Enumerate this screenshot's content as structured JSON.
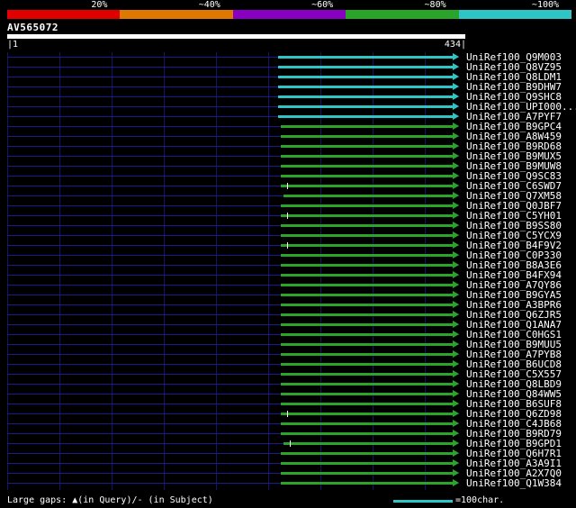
{
  "chart_data": {
    "type": "bar",
    "title": "AV565072",
    "x_range": [
      1,
      434
    ],
    "ruler_start_label": "|1",
    "ruler_end_label": "434|",
    "legend_position": "top",
    "grid": true,
    "scale_legend": [
      {
        "label": "20%",
        "color": "#e00000"
      },
      {
        "label": "~40%",
        "color": "#e07800"
      },
      {
        "label": "~60%",
        "color": "#8800c2"
      },
      {
        "label": "~80%",
        "color": "#2aa52a"
      },
      {
        "label": "~100%",
        "color": "#30c5c5"
      }
    ],
    "hits": [
      {
        "label": "UniRef100_Q9M003",
        "align_start": 261,
        "align_end": 434,
        "identity": "~100%",
        "color": "#30c5c5"
      },
      {
        "label": "UniRef100_Q8VZ95",
        "align_start": 261,
        "align_end": 434,
        "identity": "~100%",
        "color": "#30c5c5"
      },
      {
        "label": "UniRef100_Q8LDM1",
        "align_start": 261,
        "align_end": 434,
        "identity": "~100%",
        "color": "#30c5c5"
      },
      {
        "label": "UniRef100_B9DHW7",
        "align_start": 261,
        "align_end": 434,
        "identity": "~100%",
        "color": "#30c5c5"
      },
      {
        "label": "UniRef100_Q9SHC8",
        "align_start": 261,
        "align_end": 434,
        "identity": "~100%",
        "color": "#30c5c5"
      },
      {
        "label": "UniRef100_UPI000...",
        "align_start": 261,
        "align_end": 434,
        "identity": "~100%",
        "color": "#30c5c5"
      },
      {
        "label": "UniRef100_A7PYF7",
        "align_start": 261,
        "align_end": 434,
        "identity": "~100%",
        "color": "#30c5c5"
      },
      {
        "label": "UniRef100_B9GPC4",
        "align_start": 263,
        "align_end": 434,
        "identity": "~80%",
        "color": "#2aa52a"
      },
      {
        "label": "UniRef100_A8W459",
        "align_start": 263,
        "align_end": 434,
        "identity": "~80%",
        "color": "#2aa52a"
      },
      {
        "label": "UniRef100_B9RD68",
        "align_start": 263,
        "align_end": 434,
        "identity": "~80%",
        "color": "#2aa52a"
      },
      {
        "label": "UniRef100_B9MUX5",
        "align_start": 263,
        "align_end": 434,
        "identity": "~80%",
        "color": "#2aa52a"
      },
      {
        "label": "UniRef100_B9MUW8",
        "align_start": 263,
        "align_end": 434,
        "identity": "~80%",
        "color": "#2aa52a"
      },
      {
        "label": "UniRef100_Q9SC83",
        "align_start": 263,
        "align_end": 434,
        "identity": "~80%",
        "color": "#2aa52a"
      },
      {
        "label": "UniRef100_C6SWD7",
        "align_start": 263,
        "align_end": 434,
        "identity": "~80%",
        "color": "#2aa52a",
        "gap_tick": true,
        "tick_pos": 269
      },
      {
        "label": "UniRef100_Q7XM58",
        "align_start": 266,
        "align_end": 434,
        "identity": "~80%",
        "color": "#2aa52a"
      },
      {
        "label": "UniRef100_Q0JBF7",
        "align_start": 263,
        "align_end": 434,
        "identity": "~80%",
        "color": "#2aa52a"
      },
      {
        "label": "UniRef100_C5YH01",
        "align_start": 263,
        "align_end": 434,
        "identity": "~80%",
        "color": "#2aa52a",
        "gap_tick": true,
        "tick_pos": 269
      },
      {
        "label": "UniRef100_B9SS80",
        "align_start": 263,
        "align_end": 434,
        "identity": "~80%",
        "color": "#2aa52a"
      },
      {
        "label": "UniRef100_C5YCX9",
        "align_start": 263,
        "align_end": 434,
        "identity": "~80%",
        "color": "#2aa52a"
      },
      {
        "label": "UniRef100_B4F9V2",
        "align_start": 263,
        "align_end": 434,
        "identity": "~80%",
        "color": "#2aa52a",
        "gap_tick": true,
        "tick_pos": 269
      },
      {
        "label": "UniRef100_C0P330",
        "align_start": 263,
        "align_end": 434,
        "identity": "~80%",
        "color": "#2aa52a"
      },
      {
        "label": "UniRef100_B8A3E6",
        "align_start": 263,
        "align_end": 434,
        "identity": "~80%",
        "color": "#2aa52a"
      },
      {
        "label": "UniRef100_B4FX94",
        "align_start": 263,
        "align_end": 434,
        "identity": "~80%",
        "color": "#2aa52a"
      },
      {
        "label": "UniRef100_A7QY86",
        "align_start": 263,
        "align_end": 434,
        "identity": "~80%",
        "color": "#2aa52a"
      },
      {
        "label": "UniRef100_B9GYA5",
        "align_start": 263,
        "align_end": 434,
        "identity": "~80%",
        "color": "#2aa52a"
      },
      {
        "label": "UniRef100_A3BPR6",
        "align_start": 263,
        "align_end": 434,
        "identity": "~80%",
        "color": "#2aa52a"
      },
      {
        "label": "UniRef100_Q6ZJR5",
        "align_start": 263,
        "align_end": 434,
        "identity": "~80%",
        "color": "#2aa52a"
      },
      {
        "label": "UniRef100_Q1ANA7",
        "align_start": 263,
        "align_end": 434,
        "identity": "~80%",
        "color": "#2aa52a"
      },
      {
        "label": "UniRef100_C0HGS1",
        "align_start": 263,
        "align_end": 434,
        "identity": "~80%",
        "color": "#2aa52a"
      },
      {
        "label": "UniRef100_B9MUU5",
        "align_start": 263,
        "align_end": 434,
        "identity": "~80%",
        "color": "#2aa52a"
      },
      {
        "label": "UniRef100_A7PYB8",
        "align_start": 263,
        "align_end": 434,
        "identity": "~80%",
        "color": "#2aa52a"
      },
      {
        "label": "UniRef100_B6UCD8",
        "align_start": 263,
        "align_end": 434,
        "identity": "~80%",
        "color": "#2aa52a"
      },
      {
        "label": "UniRef100_C5X557",
        "align_start": 263,
        "align_end": 434,
        "identity": "~80%",
        "color": "#2aa52a"
      },
      {
        "label": "UniRef100_Q8LBD9",
        "align_start": 263,
        "align_end": 434,
        "identity": "~80%",
        "color": "#2aa52a"
      },
      {
        "label": "UniRef100_Q84WW5",
        "align_start": 263,
        "align_end": 434,
        "identity": "~80%",
        "color": "#2aa52a"
      },
      {
        "label": "UniRef100_B6SUF8",
        "align_start": 263,
        "align_end": 434,
        "identity": "~80%",
        "color": "#2aa52a"
      },
      {
        "label": "UniRef100_Q6ZD98",
        "align_start": 263,
        "align_end": 434,
        "identity": "~80%",
        "color": "#2aa52a",
        "gap_tick": true,
        "tick_pos": 269
      },
      {
        "label": "UniRef100_C4JB68",
        "align_start": 263,
        "align_end": 434,
        "identity": "~80%",
        "color": "#2aa52a"
      },
      {
        "label": "UniRef100_B9RD79",
        "align_start": 263,
        "align_end": 434,
        "identity": "~80%",
        "color": "#2aa52a"
      },
      {
        "label": "UniRef100_B9GPD1",
        "align_start": 266,
        "align_end": 434,
        "identity": "~80%",
        "color": "#2aa52a",
        "gap_tick": true,
        "tick_pos": 272
      },
      {
        "label": "UniRef100_Q6H7R1",
        "align_start": 263,
        "align_end": 434,
        "identity": "~80%",
        "color": "#2aa52a"
      },
      {
        "label": "UniRef100_A3A9I1",
        "align_start": 263,
        "align_end": 434,
        "identity": "~80%",
        "color": "#2aa52a"
      },
      {
        "label": "UniRef100_A2X7Q0",
        "align_start": 263,
        "align_end": 434,
        "identity": "~80%",
        "color": "#2aa52a"
      },
      {
        "label": "UniRef100_Q1W384",
        "align_start": 263,
        "align_end": 434,
        "identity": "~80%",
        "color": "#2aa52a"
      }
    ]
  },
  "footer": {
    "gaps_label": "Large gaps: ▲(in Query)/- (in Subject)",
    "ruler_legend": "=100char.",
    "ruler_color": "#30c5c5"
  }
}
